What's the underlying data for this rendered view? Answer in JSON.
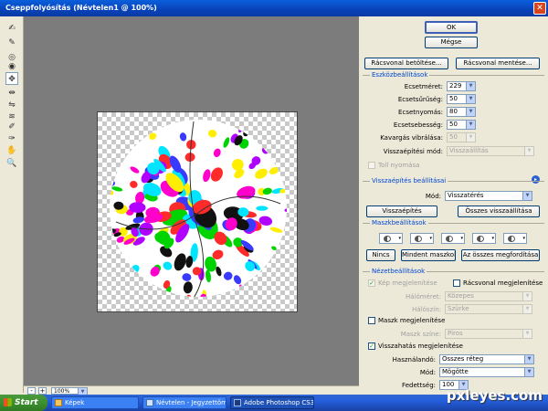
{
  "window": {
    "title": "Cseppfolyósítás (Névtelen1 @ 100%)"
  },
  "toolbox": {
    "tools": [
      {
        "icon": "warp-tool-icon",
        "glyph": "✍"
      },
      {
        "icon": "reconstruct-tool-icon",
        "glyph": "✎"
      },
      {
        "icon": "twirl-clockwise-tool-icon",
        "glyph": "◎"
      },
      {
        "icon": "pucker-tool-icon",
        "glyph": "◉"
      },
      {
        "icon": "bloat-tool-icon",
        "glyph": "✥"
      },
      {
        "icon": "push-left-tool-icon",
        "glyph": "⇹"
      },
      {
        "icon": "mirror-tool-icon",
        "glyph": "⇋"
      },
      {
        "icon": "turbulence-tool-icon",
        "glyph": "≋"
      },
      {
        "icon": "freeze-mask-tool-icon",
        "glyph": "✐"
      },
      {
        "icon": "thaw-mask-tool-icon",
        "glyph": "✑"
      },
      {
        "icon": "hand-tool-icon",
        "glyph": "✋"
      },
      {
        "icon": "zoom-tool-icon",
        "glyph": "🔍"
      }
    ]
  },
  "status": {
    "zoom": "100%",
    "minus": "-",
    "plus": "+"
  },
  "buttons": {
    "ok": "OK",
    "cancel": "Mégse",
    "load_mesh": "Rácsvonal betöltése...",
    "save_mesh": "Rácsvonal mentése..."
  },
  "tool_options": {
    "title": "Eszközbeállítások",
    "brush_size": {
      "label": "Ecsetméret:",
      "value": "229"
    },
    "brush_density": {
      "label": "Ecsetsűrűség:",
      "value": "50"
    },
    "brush_pressure": {
      "label": "Ecsetnyomás:",
      "value": "80"
    },
    "brush_rate": {
      "label": "Ecsetsebesség:",
      "value": "50"
    },
    "turbulent_jitter": {
      "label": "Kavargás vibrálása:",
      "value": "50"
    },
    "reconstruct_mode": {
      "label": "Visszaépítési mód:",
      "value": "Visszaállítás"
    },
    "stylus_pressure": "Toll nyomása"
  },
  "reconstruct_options": {
    "title": "Visszaépítés beállításai",
    "mode_label": "Mód:",
    "mode_value": "Visszatérés",
    "reconstruct": "Visszaépítés",
    "restore_all": "Összes visszaállítása"
  },
  "mask_options": {
    "title": "Maszkbeállítások",
    "none": "Nincs",
    "mask_all": "Mindent maszkol",
    "invert_all": "Az összes megfordítása"
  },
  "view_options": {
    "title": "Nézetbeállítások",
    "show_image": "Kép megjelenítése",
    "show_mesh": "Rácsvonal megjelenítése",
    "mesh_size_label": "Hálóméret:",
    "mesh_size_value": "Közepes",
    "mesh_color_label": "Hálószín:",
    "mesh_color_value": "Szürke",
    "show_mask": "Maszk megjelenítése",
    "mask_color_label": "Maszk színe:",
    "mask_color_value": "Piros",
    "show_backdrop": "Visszahatás megjelenítése",
    "use_label": "Használandó:",
    "use_value": "Összes réteg",
    "mode_label": "Mód:",
    "mode_value": "Mögötte",
    "opacity_label": "Fedettség:",
    "opacity_value": "100"
  },
  "taskbar": {
    "start": "Start",
    "tasks": [
      "Képek",
      "Névtelen - Jegyzettömb",
      "Adobe Photoshop CS3"
    ]
  },
  "watermark": "pxleyes.com",
  "colors": {
    "accent": "#0046d5",
    "title": "#0842b8",
    "canvas_bg": "#7c7c7c"
  }
}
